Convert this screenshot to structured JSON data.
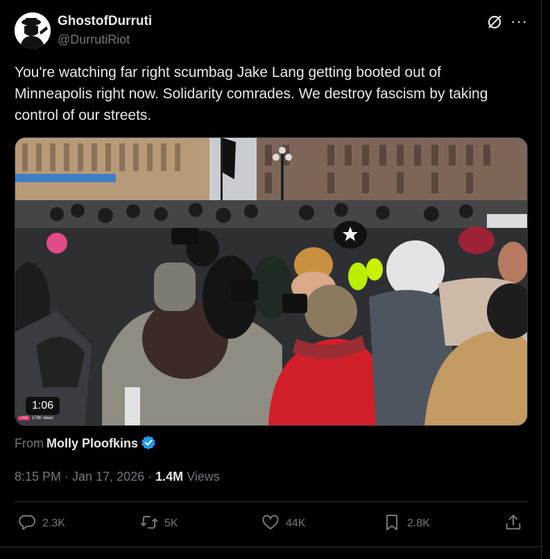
{
  "author": {
    "display_name": "GhostofDurruti",
    "handle": "@DurrutiRiot"
  },
  "tweet": {
    "text": "You're watching far right scumbag Jake Lang getting booted out of Minneapolis right now. Solidarity comrades. We destroy fascism by taking control of our streets."
  },
  "media": {
    "duration": "1:06",
    "live_badge": "LIVE",
    "live_views": "170K views"
  },
  "source": {
    "prefix": "From",
    "name": "Molly Ploofkins"
  },
  "meta": {
    "time": "8:15 PM",
    "date": "Jan 17, 2026",
    "views_count": "1.4M",
    "views_label": "Views"
  },
  "actions": {
    "replies": "2.3K",
    "reposts": "5K",
    "likes": "44K",
    "bookmarks": "2.8K"
  },
  "colors": {
    "background": "#000000",
    "text": "#e7e9ea",
    "muted": "#71767b",
    "border": "#2f3336",
    "verified": "#1d9bf0"
  },
  "icons": [
    "grok-icon",
    "more-icon",
    "verified-badge-icon",
    "reply-icon",
    "repost-icon",
    "like-icon",
    "bookmark-icon",
    "share-icon"
  ]
}
